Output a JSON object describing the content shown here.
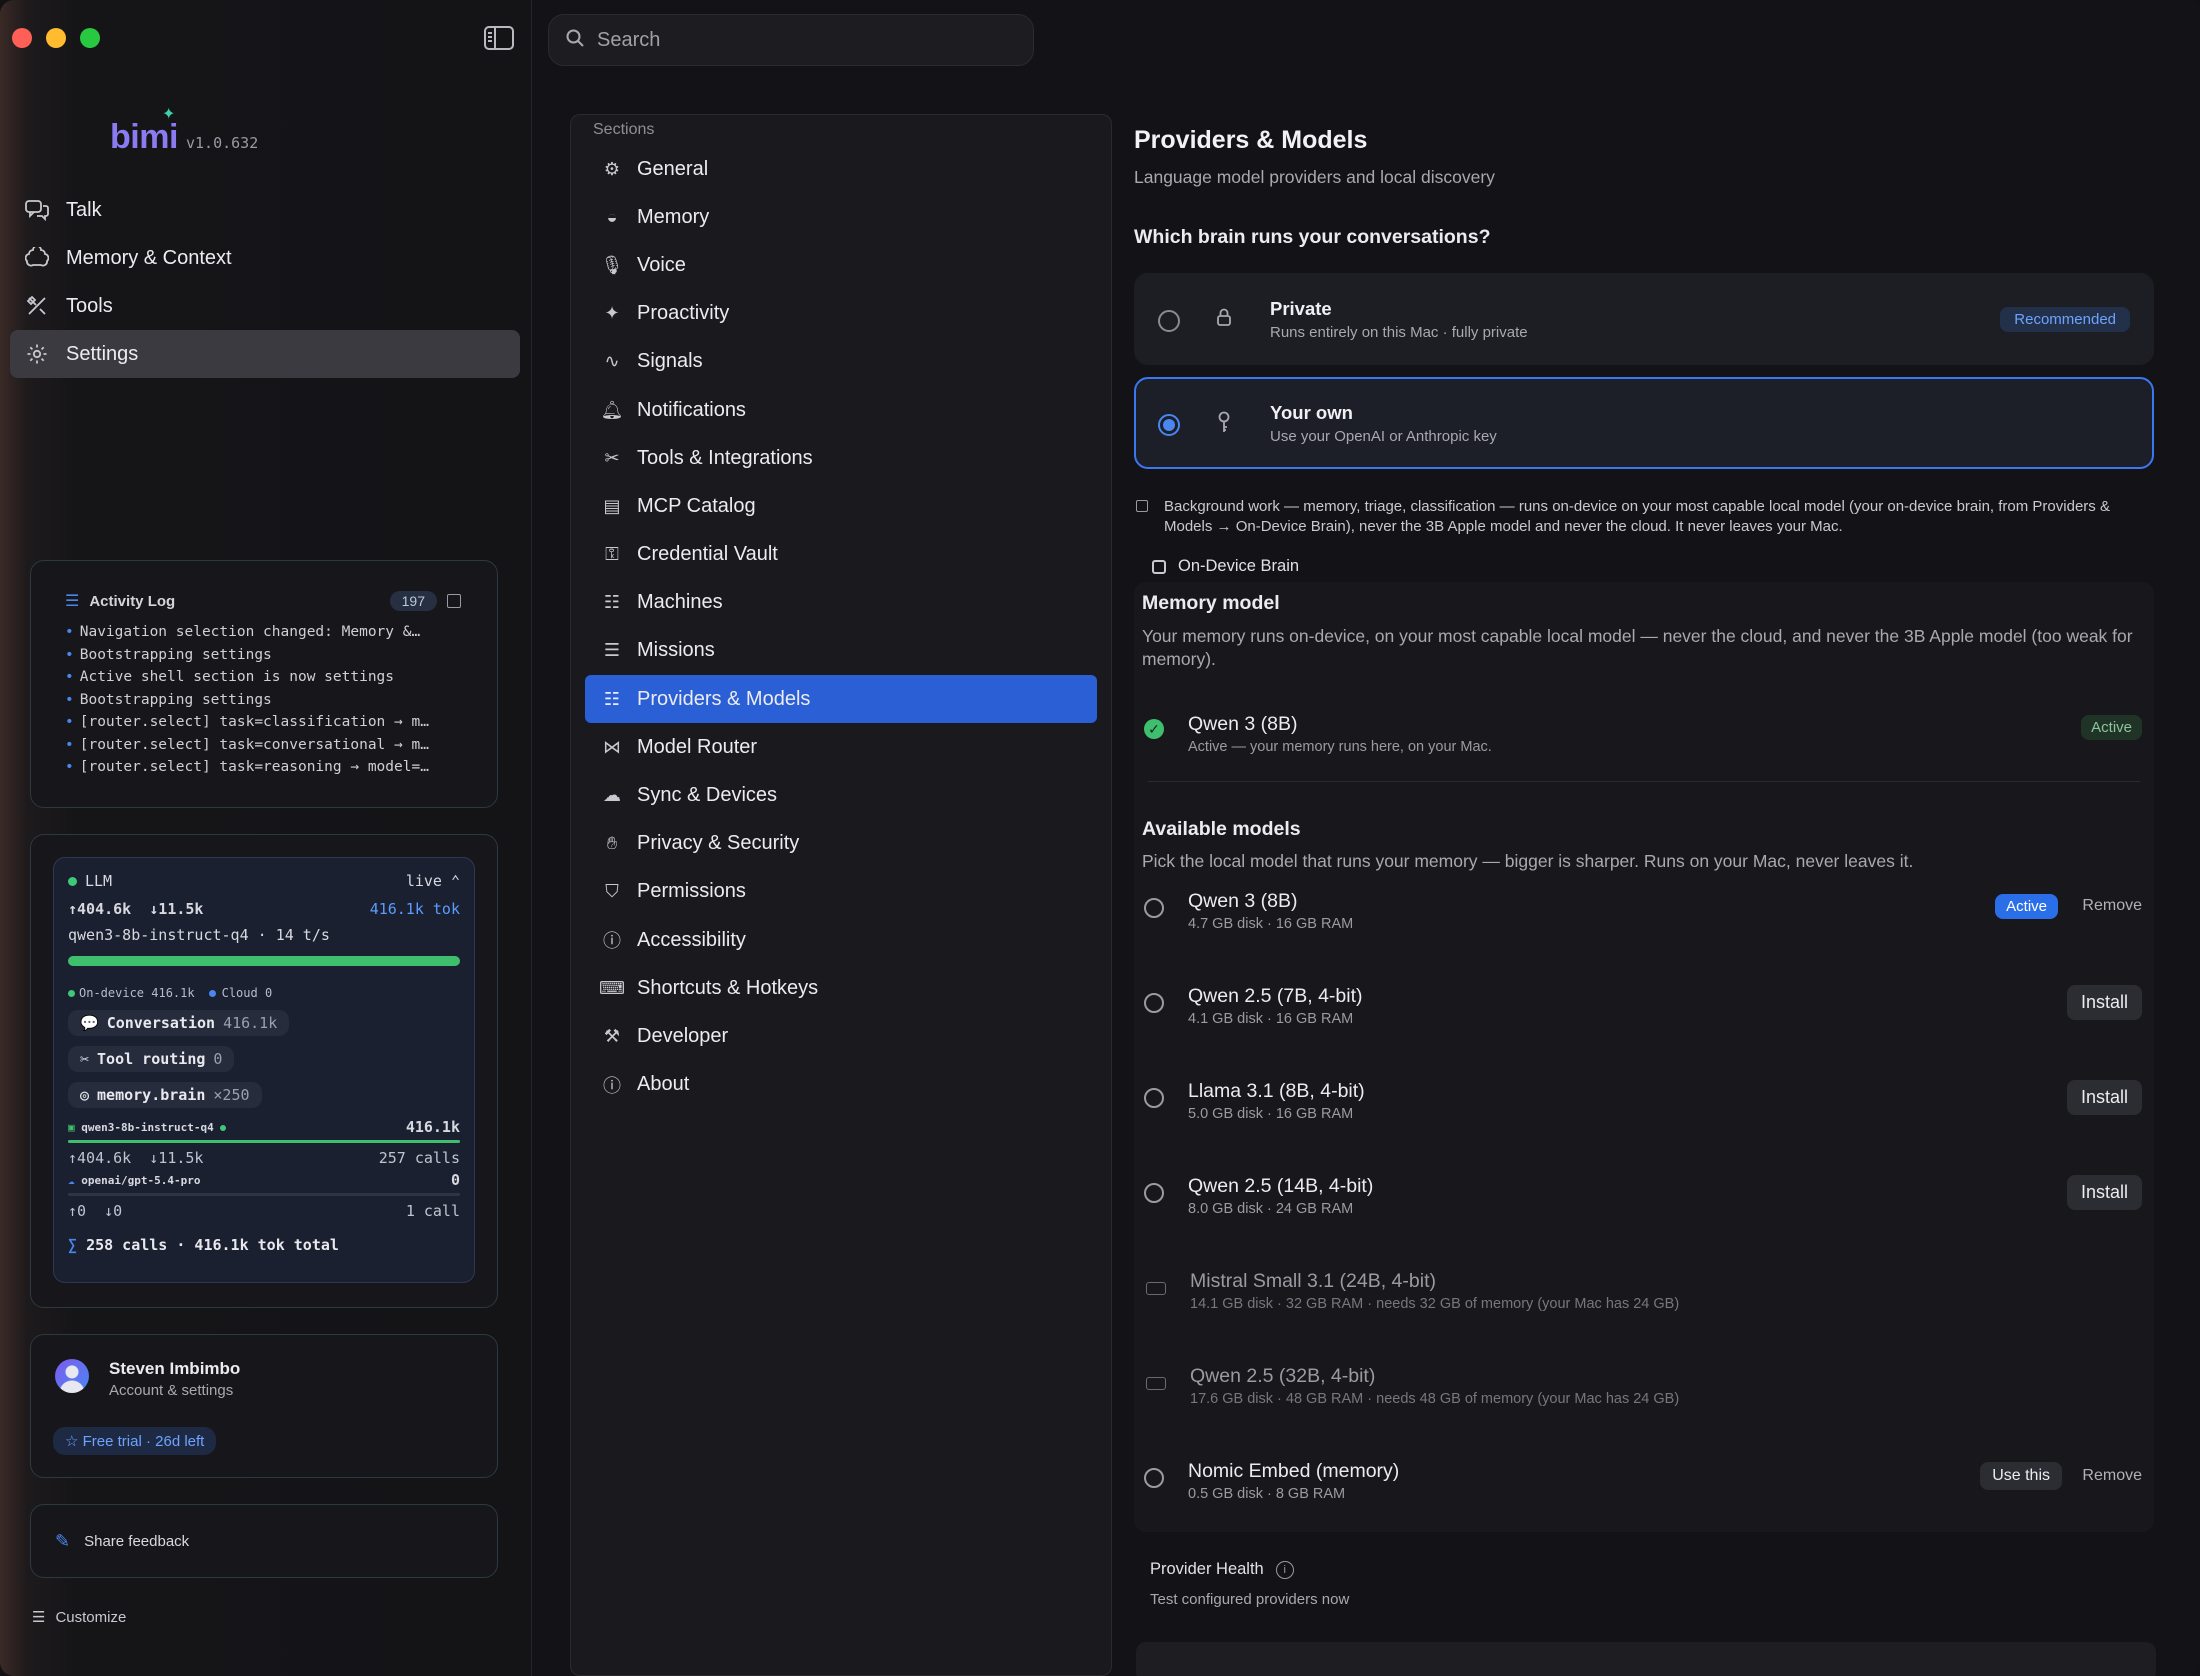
{
  "app": {
    "name": "bimi",
    "version": "v1.0.632"
  },
  "nav": {
    "items": [
      {
        "label": "Talk",
        "icon": "chat-bubbles-icon"
      },
      {
        "label": "Memory & Context",
        "icon": "brain-icon"
      },
      {
        "label": "Tools",
        "icon": "tools-icon"
      },
      {
        "label": "Settings",
        "icon": "gear-icon",
        "active": true
      }
    ]
  },
  "activity": {
    "title": "Activity Log",
    "count": "197",
    "lines": [
      "Navigation selection changed: Memory &…",
      "Bootstrapping settings",
      "Active shell section is now settings",
      "Bootstrapping settings",
      "[router.select] task=classification → m…",
      "[router.select] task=conversational → m…",
      "[router.select] task=reasoning → model=…"
    ]
  },
  "llm": {
    "label": "LLM",
    "status": "live",
    "up": "↑404.6k",
    "down": "↓11.5k",
    "total_tok": "416.1k tok",
    "model_line": "qwen3-8b-instruct-q4 · 14 t/s",
    "usage_fraction": 1.0,
    "on_device": "On-device 416.1k",
    "cloud": "Cloud 0",
    "chip_conversation": "Conversation",
    "chip_conversation_val": "416.1k",
    "chip_tool_routing": "Tool routing",
    "chip_tool_routing_val": "0",
    "chip_memory": "memory.brain",
    "chip_memory_val": "×250",
    "model_a": "qwen3-8b-instruct-q4",
    "model_a_tok": "416.1k",
    "model_a_up": "↑404.6k",
    "model_a_down": "↓11.5k",
    "model_a_calls": "257 calls",
    "model_b": "openai/gpt-5.4-pro",
    "model_b_tok": "0",
    "model_b_up": "↑0",
    "model_b_down": "↓0",
    "model_b_calls": "1 call",
    "total": "258 calls · 416.1k tok total"
  },
  "profile": {
    "name": "Steven Imbimbo",
    "sub": "Account & settings",
    "trial": "Free trial · 26d left"
  },
  "feedback": "Share feedback",
  "customize": "Customize",
  "search": {
    "placeholder": "Search"
  },
  "sections": {
    "title": "Sections",
    "items": [
      {
        "label": "General",
        "icon": "gear-icon"
      },
      {
        "label": "Memory",
        "icon": "brain-icon"
      },
      {
        "label": "Voice",
        "icon": "microphone-icon"
      },
      {
        "label": "Proactivity",
        "icon": "sparkle-icon"
      },
      {
        "label": "Signals",
        "icon": "pulse-icon"
      },
      {
        "label": "Notifications",
        "icon": "bell-icon"
      },
      {
        "label": "Tools & Integrations",
        "icon": "tools-icon"
      },
      {
        "label": "MCP Catalog",
        "icon": "catalog-icon"
      },
      {
        "label": "Credential Vault",
        "icon": "key-icon"
      },
      {
        "label": "Machines",
        "icon": "server-icon"
      },
      {
        "label": "Missions",
        "icon": "list-icon"
      },
      {
        "label": "Providers & Models",
        "icon": "server-icon",
        "active": true
      },
      {
        "label": "Model Router",
        "icon": "router-icon"
      },
      {
        "label": "Sync & Devices",
        "icon": "cloud-icon"
      },
      {
        "label": "Privacy & Security",
        "icon": "hand-icon"
      },
      {
        "label": "Permissions",
        "icon": "shield-icon"
      },
      {
        "label": "Accessibility",
        "icon": "accessibility-icon"
      },
      {
        "label": "Shortcuts & Hotkeys",
        "icon": "keyboard-icon"
      },
      {
        "label": "Developer",
        "icon": "hammer-icon"
      },
      {
        "label": "About",
        "icon": "info-icon"
      }
    ]
  },
  "page": {
    "title": "Providers & Models",
    "subtitle": "Language model providers and local discovery",
    "question": "Which brain runs your conversations?",
    "option_private_title": "Private",
    "option_private_sub": "Runs entirely on this Mac · fully private",
    "option_private_badge": "Recommended",
    "option_own_title": "Your own",
    "option_own_sub": "Use your OpenAI or Anthropic key",
    "note": "Background work — memory, triage, classification — runs on-device on your most capable local model (your on-device brain, from Providers & Models → On-Device Brain), never the 3B Apple model and never the cloud. It never leaves your Mac.",
    "on_device_brain": "On-Device Brain",
    "memory_model_title": "Memory model",
    "memory_model_desc": "Your memory runs on-device, on your most capable local model — never the cloud, and never the 3B Apple model (too weak for memory).",
    "current_model_name": "Qwen 3 (8B)",
    "current_model_meta": "Active — your memory runs here, on your Mac.",
    "current_model_badge": "Active",
    "available_title": "Available models",
    "available_desc": "Pick the local model that runs your memory — bigger is sharper. Runs on your Mac, never leaves it.",
    "models": [
      {
        "name": "Qwen 3 (8B)",
        "meta": "4.7 GB disk · 16 GB RAM",
        "badge": "Active",
        "action": "Remove"
      },
      {
        "name": "Qwen 2.5 (7B, 4-bit)",
        "meta": "4.1 GB disk · 16 GB RAM",
        "action": "Install"
      },
      {
        "name": "Llama 3.1 (8B, 4-bit)",
        "meta": "5.0 GB disk · 16 GB RAM",
        "action": "Install"
      },
      {
        "name": "Qwen 2.5 (14B, 4-bit)",
        "meta": "8.0 GB disk · 24 GB RAM",
        "action": "Install"
      },
      {
        "name": "Mistral Small 3.1 (24B, 4-bit)",
        "meta": "14.1 GB disk · 32 GB RAM · needs 32 GB of memory (your Mac has 24 GB)"
      },
      {
        "name": "Qwen 2.5 (32B, 4-bit)",
        "meta": "17.6 GB disk · 48 GB RAM · needs 48 GB of memory (your Mac has 24 GB)"
      },
      {
        "name": "Nomic Embed (memory)",
        "meta": "0.5 GB disk · 8 GB RAM",
        "action": "Use this",
        "action2": "Remove"
      }
    ],
    "health_title": "Provider Health",
    "health_link": "Test configured providers now"
  }
}
